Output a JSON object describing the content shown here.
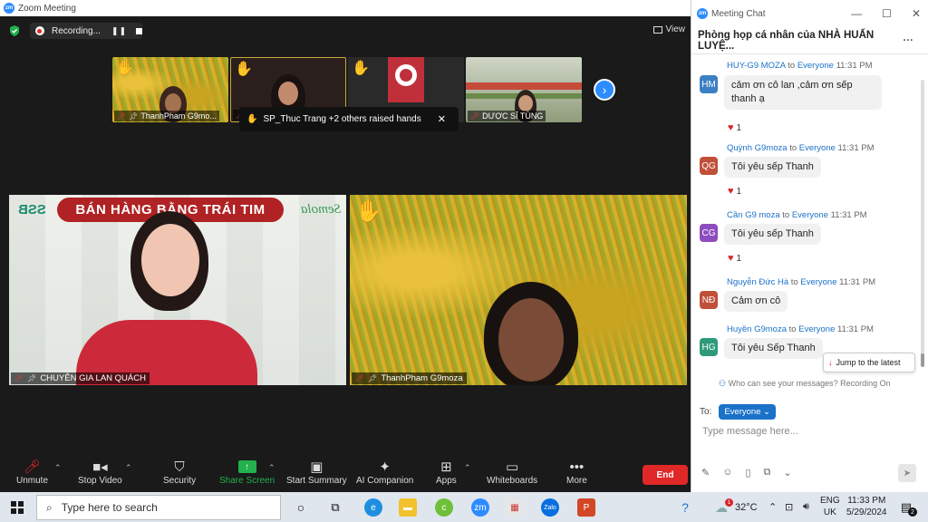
{
  "zoom": {
    "title": "Zoom Meeting",
    "recording": {
      "label": "Recording...",
      "pause_icon": "pause-icon",
      "stop_icon": "stop-icon"
    },
    "view_label": "View",
    "thumbnails": [
      {
        "name": "ThanhPham G9mo...",
        "muted": true
      },
      {
        "name": "S",
        "muted": true
      },
      {
        "name": "",
        "muted": false
      },
      {
        "name": "DƯỢC SĨ TÙNG",
        "muted": true
      }
    ],
    "raise_hand_toast": "SP_Thuc Trang +2 others raised hands",
    "main_tiles": [
      {
        "name": "CHUYÊN GIA LAN QUÁCH",
        "banner": "BÁN HÀNG BẰNG TRÁI TIM",
        "brand_left": "SSB",
        "brand_right": "Semola"
      },
      {
        "name": "ThanhPham G9moza"
      }
    ],
    "toolbar": {
      "unmute": "Unmute",
      "stop_video": "Stop Video",
      "security": "Security",
      "share_screen": "Share Screen",
      "start_summary": "Start Summary",
      "ai_companion": "AI Companion",
      "apps": "Apps",
      "whiteboards": "Whiteboards",
      "more": "More",
      "end": "End"
    },
    "colors": {
      "share_green": "#22b14c",
      "end_red": "#e02828",
      "accent_blue": "#2d8cff"
    }
  },
  "chat": {
    "window_title": "Meeting Chat",
    "header": "Phòng họp cá nhân của NHÀ HUẤN LUYỆ...",
    "messages": [
      {
        "initials": "HM",
        "color": "#3b7fc4",
        "sender": "HUY-G9 MOZA",
        "to": "to",
        "recipient": "Everyone",
        "time": "11:31 PM",
        "text_line1": "cảm ơn cô lan ,cảm ơn sếp",
        "text_line2": "thanh ạ",
        "reaction_count": "1"
      },
      {
        "initials": "QG",
        "color": "#c0503a",
        "sender": "Quỳnh G9moza",
        "to": "to",
        "recipient": "Everyone",
        "time": "11:31 PM",
        "text_line1": "Tôi yêu sếp Thanh",
        "reaction_count": "1"
      },
      {
        "initials": "CG",
        "color": "#8e4dbf",
        "sender": "Cần G9 moza",
        "to": "to",
        "recipient": "Everyone",
        "time": "11:31 PM",
        "text_line1": "Tôi yêu sếp Thanh",
        "reaction_count": "1"
      },
      {
        "initials": "NĐ",
        "color": "#c0503a",
        "sender": "Nguyễn Đức Hà",
        "to": "to",
        "recipient": "Everyone",
        "time": "11:31 PM",
        "text_line1": "Cảm ơn cô"
      },
      {
        "initials": "HG",
        "color": "#2e9a7a",
        "sender": "Huyền G9moza",
        "to": "to",
        "recipient": "Everyone",
        "time": "11:31 PM",
        "text_line1": "Tôi yêu Sếp Thanh"
      }
    ],
    "jump_latest": "Jump to the latest",
    "who_can_see": "Who can see your messages? Recording On",
    "to_label": "To:",
    "to_value": "Everyone",
    "input_placeholder": "Type message here..."
  },
  "taskbar": {
    "search_placeholder": "Type here to search",
    "temperature": "32°C",
    "lang_line1": "ENG",
    "lang_line2": "UK",
    "time": "11:33 PM",
    "date": "5/29/2024",
    "weather_badge": "1",
    "zalo_label": "Zalo",
    "zm_label": "zm",
    "notifications_count": "2"
  }
}
